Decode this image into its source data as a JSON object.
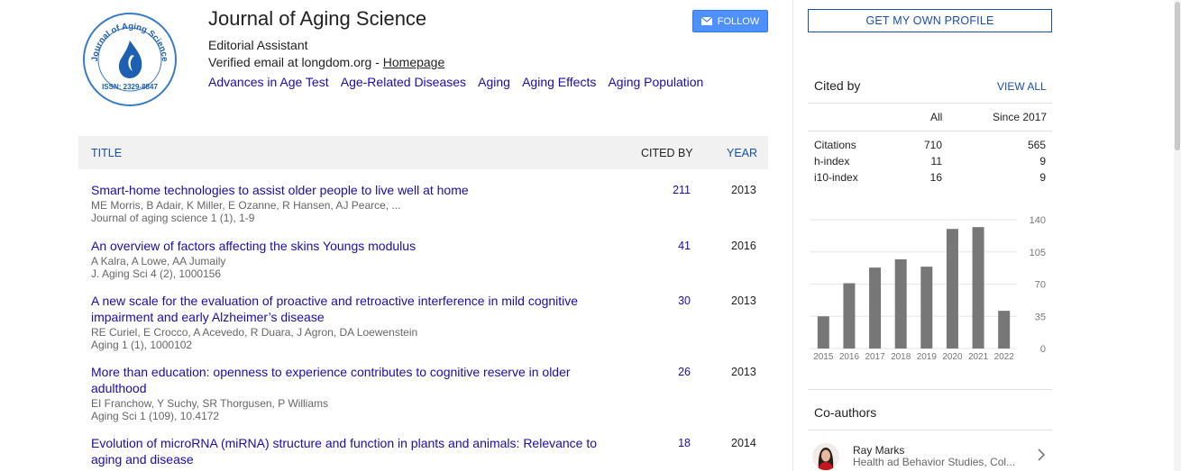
{
  "profile": {
    "name": "Journal of Aging Science",
    "affiliation": "Editorial Assistant",
    "email_text": "Verified email at longdom.org - ",
    "homepage_label": "Homepage",
    "logo_text_top": "Journal of Aging Science",
    "logo_text_bottom": "ISSN: 2329-8847",
    "interests": [
      "Advances in Age Test",
      "Age-Related Diseases",
      "Aging",
      "Aging Effects",
      "Aging Population"
    ]
  },
  "follow_label": "FOLLOW",
  "get_profile_label": "GET MY OWN PROFILE",
  "table": {
    "headers": {
      "title": "TITLE",
      "cited_by": "CITED BY",
      "year": "YEAR"
    },
    "rows": [
      {
        "title": "Smart-home technologies to assist older people to live well at home",
        "authors": "ME Morris, B Adair, K Miller, E Ozanne, R Hansen, AJ Pearce, ...",
        "source": "Journal of aging science 1 (1), 1-9",
        "cited": "211",
        "year": "2013"
      },
      {
        "title": "An overview of factors affecting the skins Youngs modulus",
        "authors": "A Kalra, A Lowe, AA Jumaily",
        "source": "J. Aging Sci 4 (2), 1000156",
        "cited": "41",
        "year": "2016"
      },
      {
        "title": "A new scale for the evaluation of proactive and retroactive interference in mild cognitive impairment and early Alzheimer’s disease",
        "authors": "RE Curiel, E Crocco, A Acevedo, R Duara, J Agron, DA Loewenstein",
        "source": "Aging 1 (1), 1000102",
        "cited": "30",
        "year": "2013"
      },
      {
        "title": "More than education: openness to experience contributes to cognitive reserve in older adulthood",
        "authors": "EI Franchow, Y Suchy, SR Thorgusen, P Williams",
        "source": "Aging Sci 1 (109), 10.4172",
        "cited": "26",
        "year": "2013"
      },
      {
        "title": "Evolution of microRNA (miRNA) structure and function in plants and animals: Relevance to aging and disease",
        "authors": "",
        "source": "",
        "cited": "18",
        "year": "2014"
      }
    ]
  },
  "cited_by": {
    "title": "Cited by",
    "view_all": "VIEW ALL",
    "col_all": "All",
    "col_since": "Since 2017",
    "stats": [
      {
        "label": "Citations",
        "all": "710",
        "since": "565"
      },
      {
        "label": "h-index",
        "all": "11",
        "since": "9"
      },
      {
        "label": "i10-index",
        "all": "16",
        "since": "9"
      }
    ]
  },
  "chart_data": {
    "type": "bar",
    "categories": [
      "2015",
      "2016",
      "2017",
      "2018",
      "2019",
      "2020",
      "2021",
      "2022"
    ],
    "values": [
      35,
      71,
      88,
      97,
      89,
      130,
      132,
      41
    ],
    "yticks": [
      "0",
      "35",
      "70",
      "105",
      "140"
    ],
    "ylim": [
      0,
      140
    ],
    "bar_color": "#777777"
  },
  "coauthors": {
    "title": "Co-authors",
    "items": [
      {
        "name": "Ray Marks",
        "affiliation": "Health ad Behavior Studies, Col..."
      }
    ]
  }
}
